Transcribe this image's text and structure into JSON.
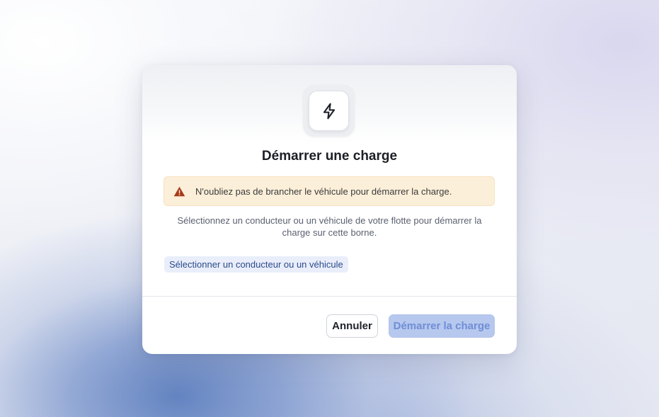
{
  "modal": {
    "title": "Démarrer une charge",
    "icon": "lightning-bolt-icon",
    "alert": {
      "icon": "warning-triangle-icon",
      "text": "N'oubliez pas de brancher le véhicule pour démarrer la charge.",
      "background": "#fcefd9",
      "icon_color": "#a8391c"
    },
    "description": "Sélectionnez un conducteur ou un véhicule de votre flotte pour démarrer la charge sur cette borne.",
    "select_link": "Sélectionner un conducteur ou un véhicule",
    "buttons": {
      "cancel": "Annuler",
      "start": "Démarrer la charge"
    },
    "colors": {
      "primary_disabled_bg": "#b7c8ee",
      "primary_disabled_text": "#6f8ed6",
      "link_bg": "#e9eefa",
      "link_text": "#2b4a8b"
    }
  }
}
